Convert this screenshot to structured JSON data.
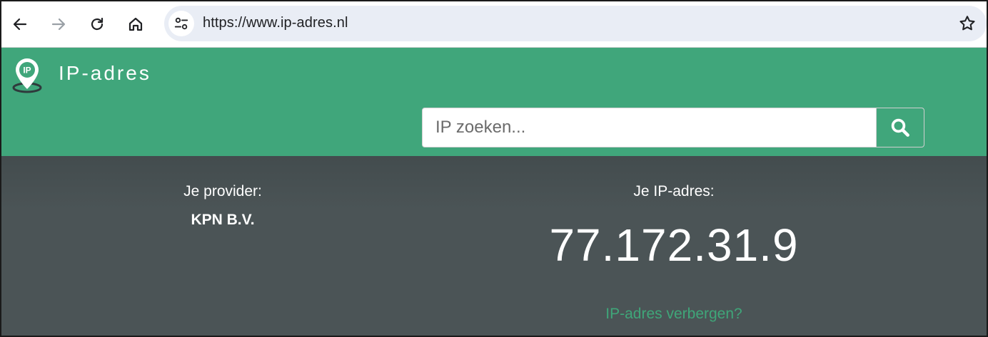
{
  "browser": {
    "url": "https://www.ip-adres.nl",
    "icons": {
      "back": "arrow-left-icon",
      "forward": "arrow-right-icon",
      "reload": "reload-icon",
      "home": "home-icon",
      "site_info": "tune-icon",
      "bookmark": "star-icon"
    }
  },
  "header": {
    "logo_badge": "IP",
    "logo_text": "IP-adres",
    "search_placeholder": "IP zoeken...",
    "search_icon": "search-icon"
  },
  "info": {
    "provider_label": "Je provider:",
    "provider_value": "KPN B.V.",
    "ip_label": "Je IP-adres:",
    "ip_value": "77.172.31.9",
    "hide_link": "IP-adres verbergen?"
  },
  "colors": {
    "header_green": "#40a67b",
    "info_background": "#4b5456",
    "link_green": "#3fa679",
    "omnibox": "#e9edf5"
  }
}
